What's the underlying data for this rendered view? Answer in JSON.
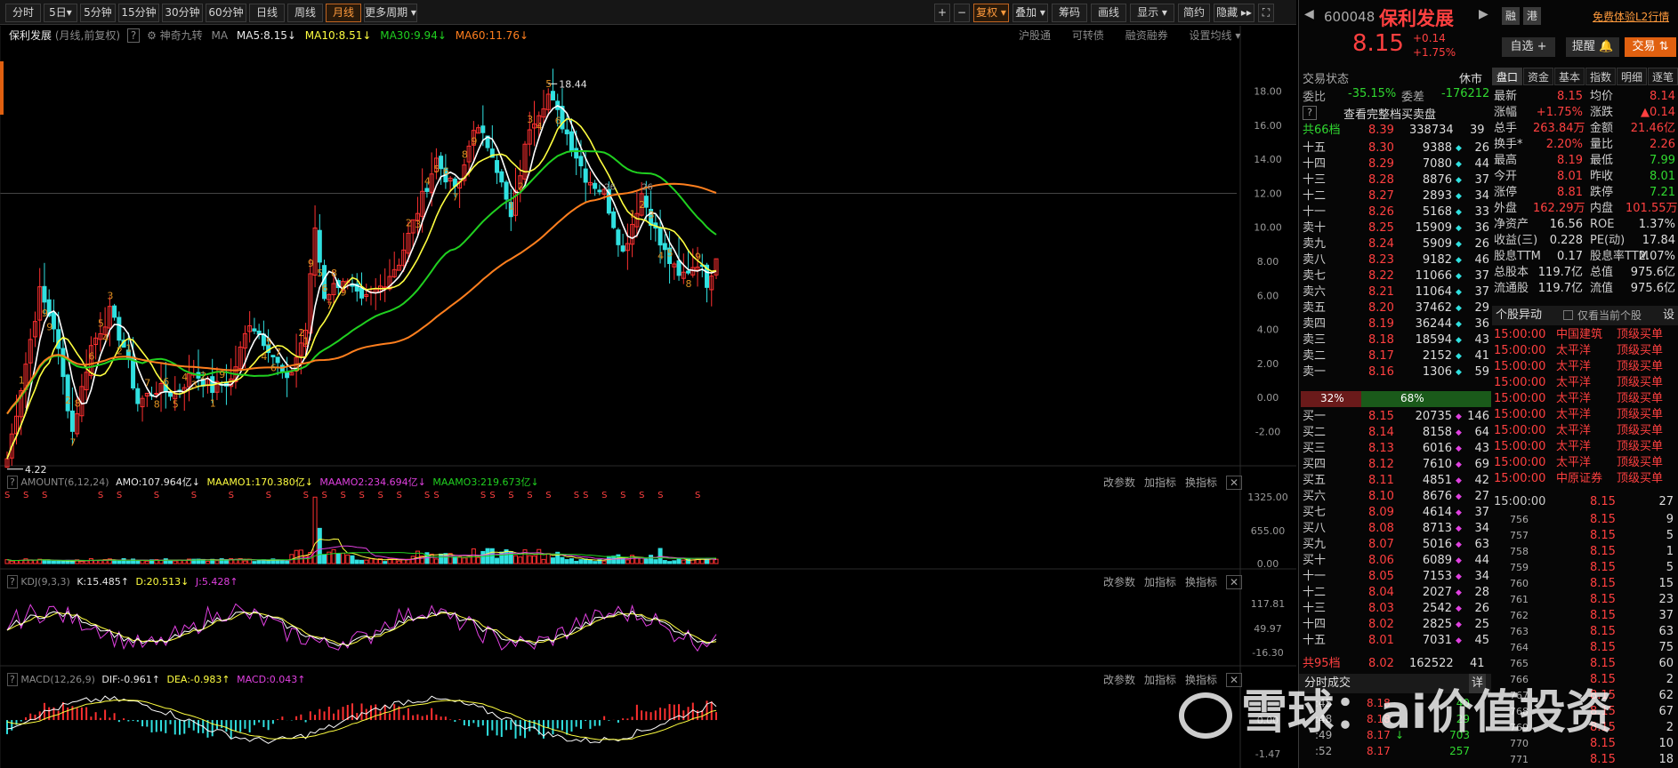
{
  "toolbar": {
    "periods": [
      "分时",
      "5日▾",
      "5分钟",
      "15分钟",
      "30分钟",
      "60分钟",
      "日线",
      "周线",
      "月线",
      "更多周期 ▾"
    ],
    "active_period": "月线",
    "right": [
      "+",
      "−",
      "复权 ▾",
      "叠加 ▾",
      "筹码",
      "画线",
      "显示 ▾",
      "简约",
      "隐藏 ▸▸",
      "⛶"
    ]
  },
  "main_legend": {
    "name": "保利发展",
    "mode": "(月线,前复权)",
    "q": "?",
    "indicator": "神奇九转",
    "ma": "MA",
    "ma5": "MA5:8.15",
    "ma10": "MA10:8.51",
    "ma30": "MA30:9.94",
    "ma60": "MA60:11.76",
    "a1": "↓",
    "a2": "↓",
    "a3": "↓",
    "a4": "↓",
    "links": [
      "沪股通",
      "可转债",
      "融资融券",
      "设置均线 ▾"
    ]
  },
  "price_axis": {
    "ticks": [
      "18.00",
      "16.00",
      "14.00",
      "12.00",
      "10.00",
      "8.00",
      "6.00",
      "4.00",
      "2.00",
      "0.00",
      "-2.00"
    ],
    "min": -3.5,
    "max": 19.5
  },
  "annotations": {
    "high": "18.44",
    "low": "4.22",
    "b1": "26",
    "b2": "26"
  },
  "td_labels": [
    "1",
    "9",
    "2",
    "7",
    "8",
    "6",
    "5",
    "4",
    "3",
    "2",
    "1",
    "9",
    "7",
    "8",
    "6",
    "5",
    "4",
    "3",
    "2",
    "1",
    "9",
    "4",
    "5",
    "6",
    "7",
    "3",
    "2",
    "1",
    "9",
    "5",
    "6",
    "7",
    "8",
    "9",
    "2",
    "3",
    "4",
    "5",
    "6",
    "7",
    "8",
    "9",
    "1",
    "2",
    "3",
    "4",
    "5",
    "6",
    "1",
    "2",
    "3",
    "4",
    "5",
    "8",
    "9"
  ],
  "signal": "S",
  "signal_red": "B",
  "volume_panel": {
    "title": "AMOUNT(6,12,24)",
    "amo": "AMO:107.964亿",
    "amo_arrow": "↓",
    "m1": "MAAMO1:170.380亿",
    "m1_arrow": "↓",
    "m2": "MAAMO2:234.694亿",
    "m2_arrow": "↓",
    "m3": "MAAMO3:219.673亿",
    "m3_arrow": "↓",
    "ticks": [
      "1325.00",
      "655.00",
      "0.00"
    ]
  },
  "kdj_panel": {
    "title": "KDJ(9,3,3)",
    "k": "K:15.485",
    "k_arrow": "↑",
    "d": "D:20.513",
    "d_arrow": "↓",
    "j": "J:5.428",
    "j_arrow": "↑",
    "ticks": [
      "117.81",
      "49.97",
      "-16.30"
    ]
  },
  "macd_panel": {
    "title": "MACD(12,26,9)",
    "dif": "DIF:-0.961",
    "dif_arrow": "↑",
    "dea": "DEA:-0.983",
    "dea_arrow": "↑",
    "macd": "MACD:0.043",
    "macd_arrow": "↑",
    "ticks": [
      "0.00",
      "-1.47"
    ]
  },
  "panel_actions": [
    "改参数",
    "加指标",
    "换指标",
    "✕"
  ],
  "stock": {
    "code": "600048",
    "name": "保利发展",
    "price": "8.15",
    "change": "+0.14",
    "pct": "+1.75%",
    "badges": [
      "融",
      "港"
    ],
    "promo": "免费体验L2行情",
    "buttons": [
      "自选 +",
      "提醒 🔔",
      "交易 ⇅"
    ]
  },
  "status": {
    "label": "交易状态",
    "value": "休市",
    "wb": "委比",
    "wb_v": "-35.15%",
    "wc": "委差",
    "wc_v": "-176212",
    "q": "?",
    "link": "查看完整档买卖盘"
  },
  "sell_total": {
    "label": "共66档",
    "price": "8.39",
    "vol": "338734",
    "n": "39"
  },
  "asks": [
    [
      "十五",
      "8.30",
      "9388",
      "26"
    ],
    [
      "十四",
      "8.29",
      "7080",
      "44"
    ],
    [
      "十三",
      "8.28",
      "8876",
      "37"
    ],
    [
      "十二",
      "8.27",
      "2893",
      "34"
    ],
    [
      "十一",
      "8.26",
      "5168",
      "33"
    ],
    [
      "卖十",
      "8.25",
      "15909",
      "36"
    ],
    [
      "卖九",
      "8.24",
      "5909",
      "26"
    ],
    [
      "卖八",
      "8.23",
      "9182",
      "46"
    ],
    [
      "卖七",
      "8.22",
      "11066",
      "37"
    ],
    [
      "卖六",
      "8.21",
      "11064",
      "37"
    ],
    [
      "卖五",
      "8.20",
      "37462",
      "29"
    ],
    [
      "卖四",
      "8.19",
      "36244",
      "36"
    ],
    [
      "卖三",
      "8.18",
      "18594",
      "43"
    ],
    [
      "卖二",
      "8.17",
      "2152",
      "41"
    ],
    [
      "卖一",
      "8.16",
      "1306",
      "59"
    ]
  ],
  "ratio": {
    "buy": "32%",
    "sell": "68%",
    "buy_frac": 0.32
  },
  "bids": [
    [
      "买一",
      "8.15",
      "20735",
      "146"
    ],
    [
      "买二",
      "8.14",
      "8158",
      "64"
    ],
    [
      "买三",
      "8.13",
      "6016",
      "43"
    ],
    [
      "买四",
      "8.12",
      "7610",
      "69"
    ],
    [
      "买五",
      "8.11",
      "4851",
      "42"
    ],
    [
      "买六",
      "8.10",
      "8676",
      "27"
    ],
    [
      "买七",
      "8.09",
      "4614",
      "37"
    ],
    [
      "买八",
      "8.08",
      "8713",
      "34"
    ],
    [
      "买九",
      "8.07",
      "5016",
      "63"
    ],
    [
      "买十",
      "8.06",
      "6089",
      "44"
    ],
    [
      "十一",
      "8.05",
      "7153",
      "34"
    ],
    [
      "十二",
      "8.04",
      "2027",
      "28"
    ],
    [
      "十三",
      "8.03",
      "2542",
      "26"
    ],
    [
      "十四",
      "8.02",
      "2825",
      "25"
    ],
    [
      "十五",
      "8.01",
      "7031",
      "45"
    ]
  ],
  "buy_total": {
    "label": "共95档",
    "price": "8.02",
    "vol": "162522",
    "n": "41"
  },
  "tabs": [
    "盘口",
    "资金",
    "基本",
    "指数",
    "明细",
    "逐笔"
  ],
  "quote": [
    [
      "最新",
      "8.15",
      "均价",
      "8.14"
    ],
    [
      "涨幅",
      "+1.75%",
      "涨跌",
      "▲0.14"
    ],
    [
      "总手",
      "263.84万",
      "金额",
      "21.46亿"
    ],
    [
      "换手*",
      "2.20%",
      "量比",
      "2.26"
    ],
    [
      "最高",
      "8.19",
      "最低",
      "7.99"
    ],
    [
      "今开",
      "8.01",
      "昨收",
      "8.01"
    ],
    [
      "涨停",
      "8.81",
      "跌停",
      "7.21"
    ],
    [
      "外盘",
      "162.29万",
      "内盘",
      "101.55万"
    ],
    [
      "净资产",
      "16.56",
      "ROE",
      "1.37%"
    ],
    [
      "收益(三)",
      "0.228",
      "PE(动)",
      "17.84"
    ],
    [
      "股息TTM",
      "0.17",
      "股息率TTM",
      "2.07%"
    ],
    [
      "总股本",
      "119.7亿",
      "总值",
      "975.6亿"
    ],
    [
      "流通股",
      "119.7亿",
      "流值",
      "975.6亿"
    ]
  ],
  "alerts": {
    "title": "个股异动",
    "only_current": "仅看当前个股",
    "set": "设",
    "rows": [
      [
        "15:00:00",
        "中国建筑",
        "顶级买单"
      ],
      [
        "15:00:00",
        "太平洋",
        "顶级买单"
      ],
      [
        "15:00:00",
        "太平洋",
        "顶级买单"
      ],
      [
        "15:00:00",
        "太平洋",
        "顶级买单"
      ],
      [
        "15:00:00",
        "太平洋",
        "顶级买单"
      ],
      [
        "15:00:00",
        "太平洋",
        "顶级买单"
      ],
      [
        "15:00:00",
        "太平洋",
        "顶级买单"
      ],
      [
        "15:00:00",
        "太平洋",
        "顶级买单"
      ],
      [
        "15:00:00",
        "太平洋",
        "顶级买单"
      ],
      [
        "15:00:00",
        "中原证券",
        "顶级买单"
      ]
    ]
  },
  "ticks_list": {
    "header": [
      "15:00:00",
      "8.15",
      "27"
    ],
    "rows": [
      [
        "756",
        "8.15",
        "9"
      ],
      [
        "757",
        "8.15",
        "5"
      ],
      [
        "758",
        "8.15",
        "1"
      ],
      [
        "759",
        "8.15",
        "5"
      ],
      [
        "760",
        "8.15",
        "15"
      ],
      [
        "761",
        "8.15",
        "23"
      ],
      [
        "762",
        "8.15",
        "37"
      ],
      [
        "763",
        "8.15",
        "63"
      ],
      [
        "764",
        "8.15",
        "75"
      ],
      [
        "765",
        "8.15",
        "60"
      ],
      [
        "766",
        "8.15",
        "2"
      ],
      [
        "767",
        "8.15",
        "62"
      ],
      [
        "768",
        "8.15",
        "67"
      ],
      [
        "769",
        "8.15",
        "2"
      ],
      [
        "770",
        "8.15",
        "10"
      ],
      [
        "771",
        "8.15",
        "18"
      ]
    ]
  },
  "trades": {
    "title": "分时成交",
    "detail": "详",
    "rows": [
      [
        ":45",
        "8.18",
        "",
        "40"
      ],
      [
        ":48",
        "8.18",
        "",
        "29"
      ],
      [
        ":49",
        "8.17",
        "↓",
        "703"
      ],
      [
        ":52",
        "8.17",
        "",
        "257"
      ]
    ]
  },
  "watermark": "雪球：ai价值投资",
  "colors": {
    "red": "#ff4040",
    "green": "#30d830",
    "white": "#ffffff",
    "yellow": "#ffff40",
    "ma30": "#20d020",
    "ma60": "#ff7f1e",
    "cyan": "#30e0e0",
    "magenta": "#e040e0",
    "accent": "#ff8c1a"
  }
}
